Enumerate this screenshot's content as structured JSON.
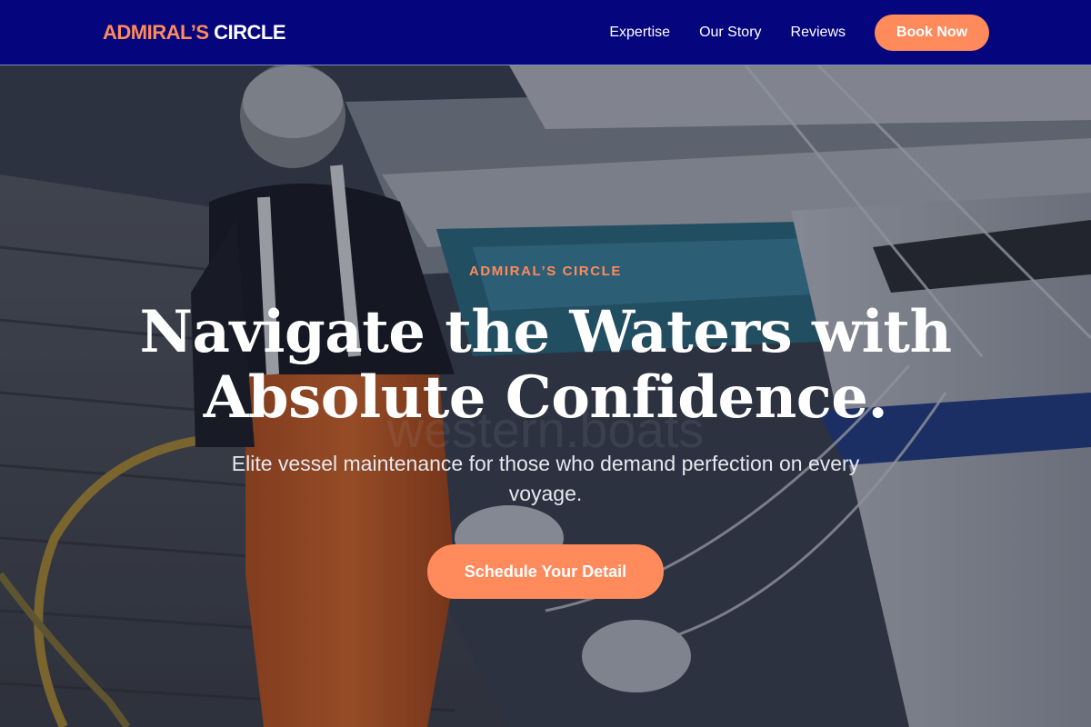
{
  "nav": {
    "logo_accent": "ADMIRAL’S",
    "logo_main": " CIRCLE",
    "links": [
      "Expertise",
      "Our Story",
      "Reviews"
    ],
    "cta_label": "Book Now"
  },
  "hero": {
    "eyebrow": "ADMIRAL’S CIRCLE",
    "headline": "Navigate the Waters with Absolute Confidence.",
    "subhead": "Elite vessel maintenance for those who demand perfection on every voyage.",
    "cta_label": "Schedule Your Detail",
    "photo_watermark": "western.boats"
  },
  "colors": {
    "nav_background": "#05057d",
    "accent": "#ff8a5b",
    "text_light": "#ffffff"
  },
  "icons": {
    "hero_photo": "marina-worker-photo"
  }
}
